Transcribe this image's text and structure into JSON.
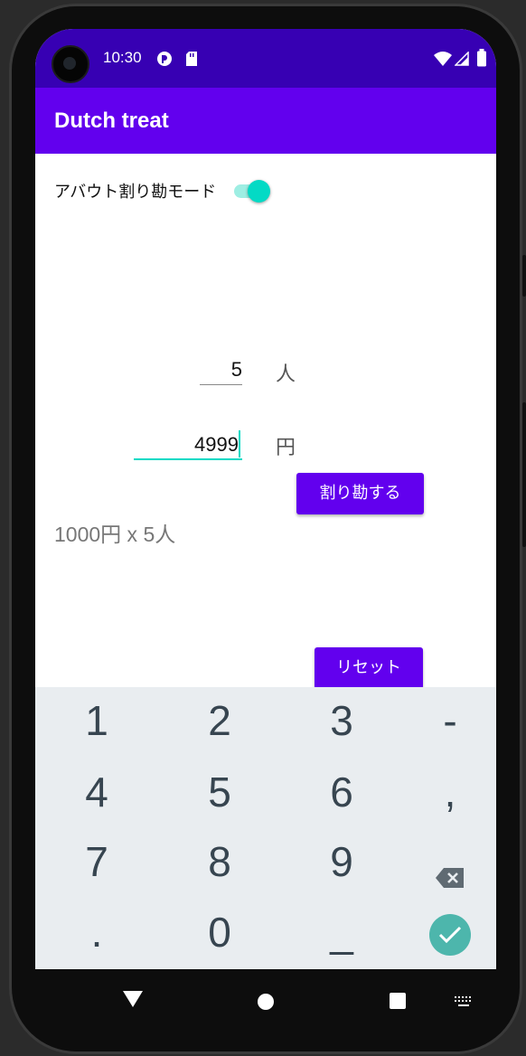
{
  "status_bar": {
    "time": "10:30"
  },
  "app_bar": {
    "title": "Dutch treat"
  },
  "switch": {
    "label": "アバウト割り勘モード",
    "on": true
  },
  "people": {
    "value": "5",
    "unit": "人"
  },
  "amount": {
    "value": "4999",
    "unit": "円"
  },
  "split_button": {
    "label": "割り勘する"
  },
  "result": {
    "text": "1000円 x 5人"
  },
  "reset_button": {
    "label": "リセット"
  },
  "keyboard": {
    "keys": [
      "1",
      "2",
      "3",
      "-",
      "4",
      "5",
      "6",
      ",",
      "7",
      "8",
      "9",
      ".",
      "0",
      "_"
    ],
    "accent": "#4db6ac"
  },
  "colors": {
    "status_bar": "#3700b3",
    "primary": "#6200ee",
    "switch": "#03dac5"
  }
}
